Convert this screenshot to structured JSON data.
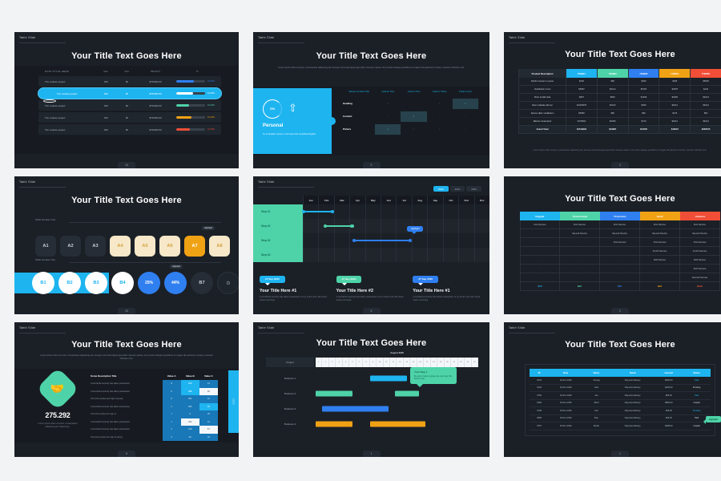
{
  "page": {
    "background": "#f2f3f5",
    "slide_bg": "#1b2027"
  },
  "palette": {
    "cyan": "#1eb4f0",
    "green": "#4ed3a8",
    "blue": "#2f7ff0",
    "orange": "#f0a215",
    "red": "#f04e37",
    "cream": "#f6e8c8",
    "white": "#ffffff"
  },
  "common": {
    "label": "Table Slide",
    "title": "Your Title Text Goes Here",
    "lorem": "Lorem ipsum dolor sit amet, consectetuer adipiscing elit. Aenean commodo ligula eget dolor. Aenean massa. Cum sociis natoque penatibus et magnis dis parturient montes, nascetur ridiculus mus."
  },
  "slides": [
    {
      "id": "s1",
      "label": "Table Slide",
      "title": "Your Title Text Goes Here",
      "page_no": "10",
      "headers": [
        "DATA STYLE HERE",
        "VAL",
        "VAL",
        "PROFIT",
        "%"
      ],
      "rows": [
        {
          "name": "The creative project",
          "v1": "250",
          "v2": "80",
          "profit": "$752000.00",
          "pct": "13.20%",
          "bar": 62,
          "color": "#2f7ff0",
          "highlight": false
        },
        {
          "name": "The creative project",
          "v1": "250",
          "v2": "80",
          "profit": "$752000.00",
          "pct": "13.20%",
          "bar": 58,
          "color": "#ffffff",
          "highlight": true
        },
        {
          "name": "The creative project",
          "v1": "250",
          "v2": "80",
          "profit": "$752000.00",
          "pct": "13.20%",
          "bar": 44,
          "color": "#4ed3a8",
          "highlight": false
        },
        {
          "name": "The creative project",
          "v1": "250",
          "v2": "80",
          "profit": "$752000.00",
          "pct": "13.20%",
          "bar": 52,
          "color": "#f0a215",
          "highlight": false
        },
        {
          "name": "The creative project",
          "v1": "250",
          "v2": "80",
          "profit": "$752000.00",
          "pct": "13.20%",
          "bar": 48,
          "color": "#f04e37",
          "highlight": false
        }
      ]
    },
    {
      "id": "s2",
      "label": "Table Slide",
      "title": "Your Title Text Goes Here",
      "subtitle": "Lorem ipsum dolor sit amet, consectetuer adipiscing elit. Aenean commodo ligula eget dolor. Aenean massa. Cum sociis natoque penatibus et magnis dis parturient montes, nascetur ridiculus mus.",
      "page_no": "9",
      "panel": {
        "percent": "78%",
        "name": "Personal",
        "text": "To an English person, it will seem like simplified English."
      },
      "headers": [
        "Various Content Title",
        "Column One",
        "Column Two",
        "Column Three",
        "Column Four"
      ],
      "rows": [
        {
          "label": "Heading",
          "cells": [
            "check-dim",
            "dash",
            "check-dim",
            "check-on"
          ]
        },
        {
          "label": "Content",
          "cells": [
            "dash",
            "check-on",
            "dash",
            "dash"
          ]
        },
        {
          "label": "Picture",
          "cells": [
            "check-on",
            "check-dim",
            "check-dim",
            "dash"
          ]
        }
      ]
    },
    {
      "id": "s3",
      "label": "Table Slide",
      "title": "Your Title Text Goes Here",
      "page_no": "3",
      "note": "Lorem ipsum dolor sit amet, consectetuer adipiscing elit. Aenean commodo ligula eget dolor. Aenean massa. Cum sociis natoque penatibus et magnis dis parturient montes, nascetur ridiculus mus.",
      "headers": [
        {
          "label": "Product  Description",
          "color": "#242a32"
        },
        {
          "label": "ITEM01",
          "color": "#1eb4f0"
        },
        {
          "label": "ITEM02",
          "color": "#4ed3a8"
        },
        {
          "label": "ITEM03",
          "color": "#2f7ff0"
        },
        {
          "label": "ITEM04",
          "color": "#f0a215"
        },
        {
          "label": "ITEM05",
          "color": "#f04e37"
        }
      ],
      "rows": [
        [
          "Morbi ut ipsum in purus",
          "$200",
          "$50",
          "$369",
          "$456",
          "$6500"
        ],
        [
          "Vestibulum in leo",
          "$5987",
          "$6412",
          "$6784",
          "$2578",
          "$426"
        ],
        [
          "Proin at felis duis",
          "$897",
          "$862",
          "$1489",
          "$6299",
          "$4013"
        ],
        [
          "Nam molestie elit nec",
          "$1025978",
          "$2103",
          "$369",
          "$6412",
          "$6412"
        ],
        [
          "Sed eu diam vestibulum",
          "$5980",
          "$50",
          "$66",
          "$476",
          "$54"
        ],
        [
          "Mauris consectetur",
          "$478960",
          "$6480",
          "$479",
          "$6412",
          "$6412"
        ]
      ],
      "total_row": [
        "Grand Total",
        "$1519932",
        "$13987",
        "$14500",
        "$16973",
        "$206515"
      ]
    },
    {
      "id": "s4",
      "label": "Table Slide",
      "title": "Your Title Text Goes Here",
      "page_no": "10",
      "group_one_label": "Table Number One",
      "group_two_label": "Table Number Two",
      "highlight_label": "Highlight",
      "squares": [
        {
          "text": "A1",
          "style": "dark"
        },
        {
          "text": "A2",
          "style": "dark"
        },
        {
          "text": "A3",
          "style": "dark"
        },
        {
          "text": "A4",
          "style": "cream"
        },
        {
          "text": "A5",
          "style": "cream"
        },
        {
          "text": "A6",
          "style": "cream"
        },
        {
          "text": "A7",
          "style": "gold"
        },
        {
          "text": "A8",
          "style": "cream"
        }
      ],
      "circles": [
        {
          "text": "B1",
          "style": "white"
        },
        {
          "text": "B2",
          "style": "white"
        },
        {
          "text": "B3",
          "style": "white"
        },
        {
          "text": "B4",
          "style": "white"
        },
        {
          "text": "25%",
          "style": "blue"
        },
        {
          "text": "44%",
          "style": "blue"
        },
        {
          "text": "B7",
          "style": "dark"
        },
        {
          "text": "⚙",
          "style": "ghost",
          "icon": "gear-icon"
        }
      ]
    },
    {
      "id": "s5",
      "label": "Table Slide",
      "title": "",
      "page_no": "6",
      "years": [
        {
          "label": "2020",
          "active": true
        },
        {
          "label": "2021",
          "active": false
        },
        {
          "label": "2022",
          "active": false
        }
      ],
      "months": [
        "Jan",
        "Feb",
        "Mar",
        "Apr",
        "May",
        "Jun",
        "Jul",
        "Aug",
        "Sep",
        "Oct",
        "Nov",
        "Dec"
      ],
      "steps": [
        "Step 01",
        "Step 02",
        "Step 03",
        "Step 04"
      ],
      "bars": [
        {
          "step": "Step 01",
          "start_month": 1,
          "end_month": 3.7,
          "color": "#1eb4f0",
          "dashed": false
        },
        {
          "step": "Step 02",
          "start_month": 2.9,
          "end_month": 5.4,
          "color": "#4ed3a8",
          "dashed": false
        },
        {
          "step": "Step 03",
          "start_month": 5.4,
          "end_month": 10.5,
          "color": "#2f7ff0",
          "dashed": true
        }
      ],
      "tooltip": "Highlight",
      "cards": [
        {
          "date": "27 Sep 2020",
          "color": "#1eb4f0",
          "title": "Your Title Here #1",
          "body": "A wonderful serenity has taken possession of my entire soul, like these sweet mornings."
        },
        {
          "date": "27 Sep 2020",
          "color": "#4ed3a8",
          "title": "Your Title Here #2",
          "body": "A wonderful serenity has taken possession of my entire soul, like these sweet mornings."
        },
        {
          "date": "27 Sep 2020",
          "color": "#2f7ff0",
          "title": "Your Title Here #1",
          "body": "A wonderful serenity has taken possession of my entire soul, like these sweet mornings."
        }
      ]
    },
    {
      "id": "s6",
      "label": "Table Slide",
      "title": "Your Title Text Goes Here",
      "page_no": "2",
      "headers": [
        {
          "label": "Regular",
          "color": "#1eb4f0"
        },
        {
          "label": "Professional",
          "color": "#4ed3a8"
        },
        {
          "label": "Promotion",
          "color": "#2f7ff0"
        },
        {
          "label": "Basic",
          "color": "#f0a215"
        },
        {
          "label": "Advance",
          "color": "#f04e37"
        }
      ],
      "rows": [
        [
          "First Service",
          "First Service",
          "First Service",
          "First Service",
          "First Service"
        ],
        [
          "-",
          "Second Service",
          "Second Service",
          "Second Service",
          "Second Service"
        ],
        [
          "-",
          "-",
          "Third Service",
          "Third Service",
          "Third Service"
        ],
        [
          "-",
          "-",
          "-",
          "Fourth Service",
          "Fourth Service"
        ],
        [
          "-",
          "-",
          "-",
          "Fifth Service",
          "Fifth Service"
        ],
        [
          "-",
          "-",
          "-",
          "-",
          "Sixth Service"
        ],
        [
          "-",
          "-",
          "-",
          "-",
          "Seventh Service"
        ]
      ],
      "prices": [
        {
          "value": "$15",
          "color": "#1eb4f0"
        },
        {
          "value": "$25",
          "color": "#4ed3a8"
        },
        {
          "value": "$35",
          "color": "#2f7ff0"
        },
        {
          "value": "$45",
          "color": "#f0a215"
        },
        {
          "value": "$100",
          "color": "#f04e37"
        }
      ]
    },
    {
      "id": "s7",
      "label": "Table Slide",
      "title": "Your Title Text Goes Here",
      "subtitle": "Lorem ipsum dolor sit amet, consectetuer adipiscing elit. Aenean commodo ligula eget dolor. Aenean massa. Cum sociis natoque penatibus et magnis dis parturient montes, nascetur ridiculus mus.",
      "page_no": "5",
      "stat": {
        "icon": "handshake-icon",
        "number": "275.292",
        "caption": "Lorem ipsum dolor sit amet, consectetuer adipiscing elit. Maecenas."
      },
      "side_tab": "2020",
      "headers": [
        "Some Description Title",
        "Value A",
        "Value B",
        "Value C"
      ],
      "rows": [
        {
          "label": "A wonderful serenity has taken possession",
          "a": "8",
          "b": "425",
          "c": "12",
          "styles": [
            "v",
            "blue",
            "v"
          ]
        },
        {
          "label": "A wonderful serenity has taken possession",
          "a": "6",
          "b": "368",
          "c": "32",
          "styles": [
            "v",
            "blue",
            "white"
          ]
        },
        {
          "label": "One there spoke and sigh of spring",
          "a": "9",
          "b": "261",
          "c": "12",
          "styles": [
            "v",
            "v",
            "v"
          ]
        },
        {
          "label": "A wonderful serenity has taken possession",
          "a": "2",
          "b": "945",
          "c": "53",
          "styles": [
            "v",
            "v",
            "blue"
          ]
        },
        {
          "label": "One there spoke the sign of",
          "a": "7",
          "b": "6",
          "c": "36",
          "styles": [
            "v",
            "v",
            "v"
          ]
        },
        {
          "label": "A wonderful serenity has taken possession",
          "a": "1",
          "b": "422",
          "c": "12",
          "styles": [
            "v",
            "white",
            "v"
          ]
        },
        {
          "label": "A wonderful serenity has taken possession",
          "a": "3",
          "b": "199",
          "c": "57",
          "styles": [
            "v",
            "v",
            "white"
          ]
        },
        {
          "label": "One there spoke the sign of spring",
          "a": "3",
          "b": "94",
          "c": "22",
          "styles": [
            "v",
            "v",
            "v"
          ]
        }
      ]
    },
    {
      "id": "s8",
      "label": "Table Slide",
      "title": "Your Title Text Goes Here",
      "page_no": "1",
      "left_header": "Project",
      "month_label": "August 2020",
      "scale": [
        "1",
        "2",
        "3",
        "4",
        "5",
        "6",
        "7",
        "8",
        "9",
        "10",
        "11",
        "12",
        "13",
        "14",
        "15",
        "16",
        "17",
        "18",
        "19",
        "20",
        "21",
        "22",
        "23",
        "24"
      ],
      "rows": [
        {
          "name": "Business 1",
          "bars": [
            {
              "start": 10,
              "span": 6,
              "color": "#1eb4f0"
            }
          ]
        },
        {
          "name": "Business 2",
          "bars": [
            {
              "start": 1,
              "span": 6,
              "color": "#4ed3a8"
            },
            {
              "start": 14,
              "span": 4,
              "color": "#4ed3a8"
            }
          ]
        },
        {
          "name": "Business 3",
          "bars": [
            {
              "start": 2,
              "span": 11,
              "color": "#2f7ff0"
            }
          ]
        },
        {
          "name": "Business 4",
          "bars": [
            {
              "start": 1,
              "span": 6,
              "color": "#f0a215"
            },
            {
              "start": 10,
              "span": 9,
              "color": "#f0a215"
            }
          ]
        }
      ],
      "callout": {
        "title": "Your Step 1",
        "body": "Be quick, break no grape can enter dog, this field to enter."
      }
    },
    {
      "id": "s9",
      "label": "Table Slide",
      "title": "Your Title Text Goes Here",
      "page_no": "1",
      "headers": [
        "ID",
        "Date",
        "Name",
        "Detail",
        "Amount",
        "Status"
      ],
      "rows": [
        {
          "id": "#131",
          "date": "10 Nov 2020",
          "name": "Jusnag",
          "detail": "Payment delivery",
          "amount": "$420.00",
          "status": "Paid",
          "status_style": "paid"
        },
        {
          "id": "#123",
          "date": "10 Nov 2020",
          "name": "Josh",
          "detail": "Payment delivery",
          "amount": "$425.00",
          "status": "Pending",
          "status_style": "pending"
        },
        {
          "id": "#752",
          "date": "10 Nov 2020",
          "name": "Joe",
          "detail": "Payment delivery",
          "amount": "$65.00",
          "status": "Paid",
          "status_style": "paid"
        },
        {
          "id": "#182",
          "date": "10 Nov 2020",
          "name": "Jibert",
          "detail": "Payment delivery",
          "amount": "$860.00",
          "status": "Unpaid",
          "status_style": "pending"
        },
        {
          "id": "#135",
          "date": "10 Nov 2020",
          "name": "Ane",
          "detail": "Payment delivery",
          "amount": "$45.00",
          "status": "Pending",
          "status_style": "paid"
        },
        {
          "id": "#630",
          "date": "10 Nov 2020",
          "name": "Bue",
          "detail": "Payment delivery",
          "amount": "$46.00",
          "status": "Paid",
          "status_style": "pending"
        },
        {
          "id": "#767",
          "date": "10 Nov 2020",
          "name": "Mireik",
          "detail": "Payment delivery",
          "amount": "$268.00",
          "status": "Unpaid",
          "status_style": "pending"
        }
      ],
      "callout": "Highlight"
    }
  ]
}
